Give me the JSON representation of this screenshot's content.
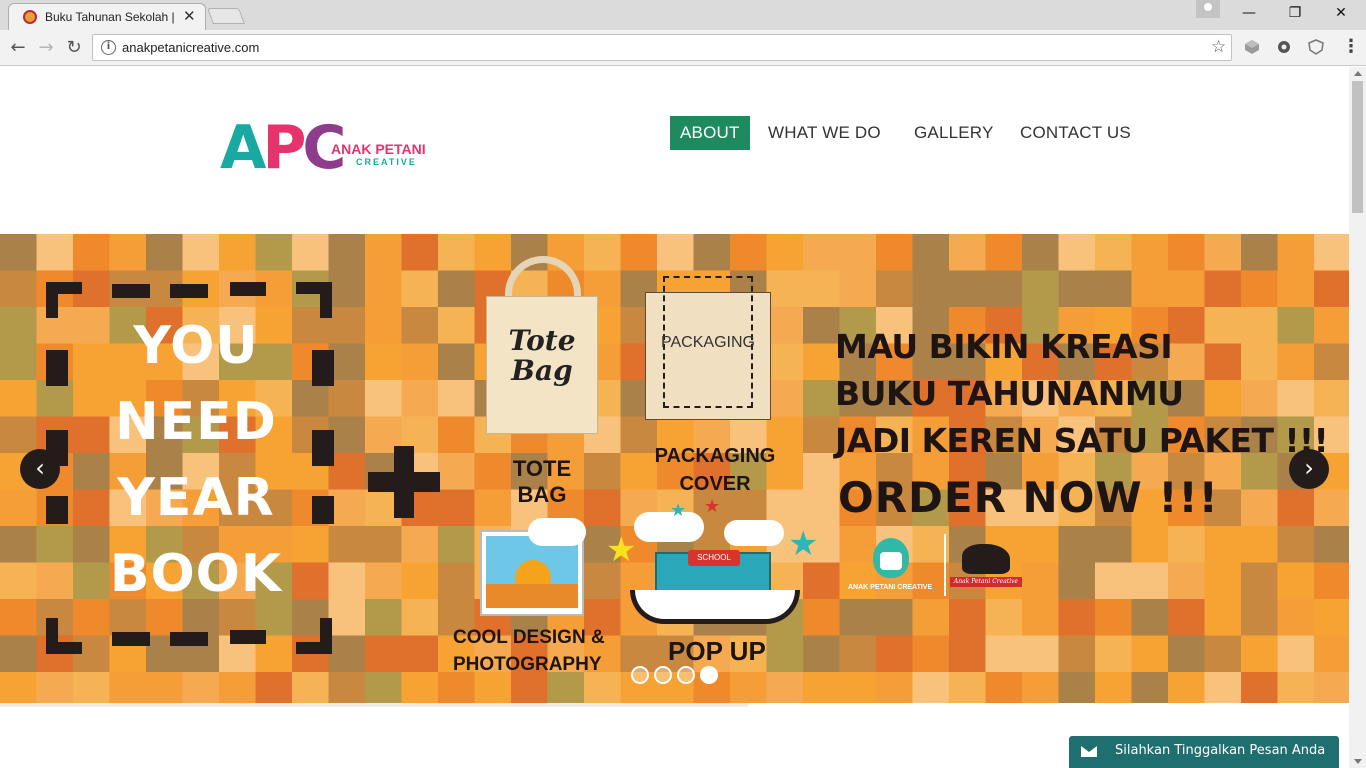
{
  "browser": {
    "tab_title": "Buku Tahunan Sekolah | A",
    "tab_close": "✕",
    "url": "anakpetanicreative.com",
    "back_glyph": "←",
    "forward_glyph": "→",
    "reload_glyph": "↻",
    "info_glyph": "i",
    "star_glyph": "☆",
    "menu_glyph": "⋮",
    "minimize_glyph": "—",
    "maximize_glyph": "❐",
    "close_glyph": "✕"
  },
  "site": {
    "logo": {
      "letters_a": "A",
      "letters_p": "P",
      "letters_c": "C",
      "name": "ANAK PETANI",
      "sub": "CREATIVE"
    },
    "nav": [
      {
        "label": "ABOUT",
        "active": true
      },
      {
        "label": "WHAT WE DO",
        "active": false
      },
      {
        "label": "GALLERY",
        "active": false
      },
      {
        "label": "CONTACT US",
        "active": false
      }
    ],
    "accent_color": "#1e8a5e"
  },
  "slider": {
    "left_lines": [
      "YOU",
      "NEED",
      "YEAR",
      "BOOK"
    ],
    "tote_text_1": "Tote",
    "tote_text_2": "Bag",
    "tote_label": "TOTE BAG",
    "packaging_text": "PACKAGING",
    "packaging_label_1": "PACKAGING",
    "packaging_label_2": "COVER",
    "design_label_1": "COOL DESIGN &",
    "design_label_2": "PHOTOGRAPHY",
    "popup_school": "SCHOOL",
    "popup_label": "POP UP",
    "promo_lines": [
      "MAU BIKIN KREASI",
      "BUKU TAHUNANMU",
      "JADI KEREN SATU PAKET !!!"
    ],
    "order": "ORDER NOW !!!",
    "mini_caption": "ANAK PETANI CREATIVE",
    "mini_ribbon": "Anak Petani Creative",
    "prev_glyph": "‹",
    "next_glyph": "›",
    "dots": 4,
    "active_dot": 4,
    "bg_color": "#f7a334"
  },
  "chat": {
    "label": "Silahkan Tinggalkan Pesan Anda",
    "color": "#1f6f70"
  }
}
